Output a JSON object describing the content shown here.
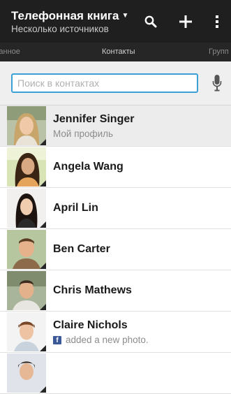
{
  "app": {
    "title": "Телефонная книга",
    "subtitle": "Несколько источников"
  },
  "toolbar": {
    "search_icon": "search-icon",
    "add_icon": "add-icon",
    "menu_icon": "overflow-menu-icon"
  },
  "tabs": [
    {
      "label": "бранное"
    },
    {
      "label": "Контакты"
    },
    {
      "label": "Групп"
    }
  ],
  "search": {
    "placeholder": "Поиск в контактах",
    "value": "",
    "mic_icon": "microphone-icon"
  },
  "contacts": [
    {
      "name": "Jennifer Singer",
      "subtitle": "Мой профиль"
    },
    {
      "name": "Angela Wang",
      "subtitle": ""
    },
    {
      "name": "April Lin",
      "subtitle": ""
    },
    {
      "name": "Ben Carter",
      "subtitle": ""
    },
    {
      "name": "Chris Mathews",
      "subtitle": ""
    },
    {
      "name": "Claire Nichols",
      "subtitle": "added a new photo."
    }
  ],
  "colors": {
    "topbar": "#1f1f1f",
    "tabbar": "#262626",
    "accent": "#3aa0d6",
    "facebook": "#3b5998"
  }
}
